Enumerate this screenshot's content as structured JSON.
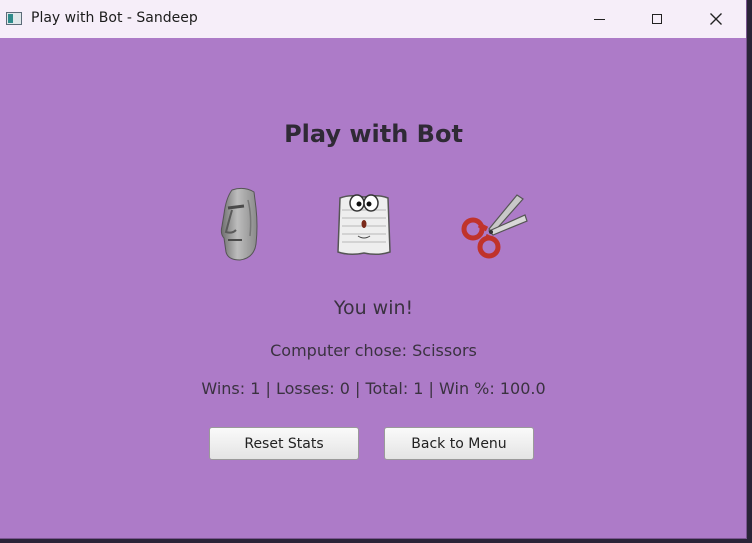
{
  "window": {
    "title": "Play with Bot - Sandeep",
    "background_color": "#ad7bc8",
    "titlebar_color": "#f6eef9",
    "controls": {
      "minimize_icon": "minimize-icon",
      "maximize_icon": "maximize-icon",
      "close_icon": "close-icon"
    }
  },
  "game": {
    "heading": "Play with Bot",
    "choices": [
      {
        "name": "Rock",
        "icon": "moai-rock-icon"
      },
      {
        "name": "Paper",
        "icon": "paper-face-icon"
      },
      {
        "name": "Scissors",
        "icon": "scissors-icon"
      }
    ],
    "result": "You win!",
    "computer_choice": "Computer chose: Scissors",
    "stats": "Wins: 1 | Losses: 0 | Total: 1 | Win %: 100.0"
  },
  "buttons": {
    "reset": "Reset Stats",
    "menu": "Back to Menu"
  }
}
